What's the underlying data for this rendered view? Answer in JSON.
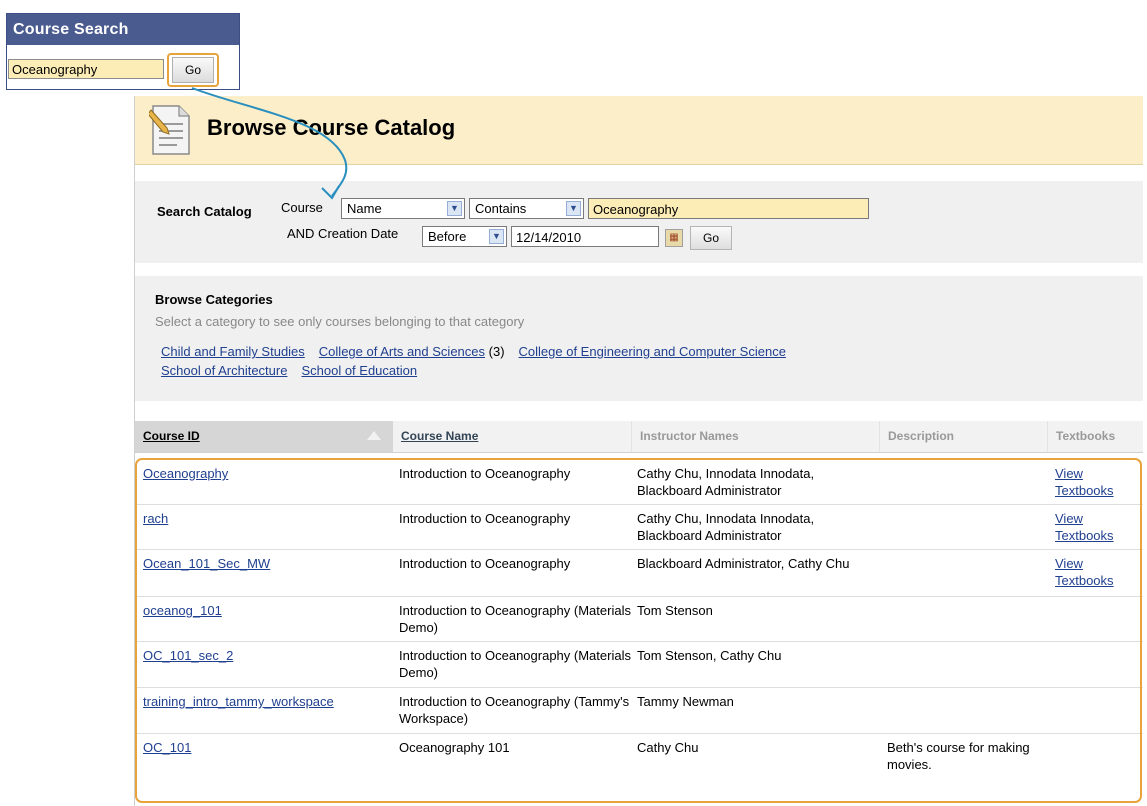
{
  "course_search": {
    "title": "Course Search",
    "input_value": "Oceanography",
    "go_label": "Go"
  },
  "catalog": {
    "title": "Browse Course Catalog",
    "search": {
      "label": "Search Catalog",
      "field_label": "Course",
      "field_select": "Name",
      "operator_select": "Contains",
      "query_value": "Oceanography",
      "date_label": "AND Creation Date",
      "date_operator": "Before",
      "date_value": "12/14/2010",
      "go_label": "Go"
    },
    "browse": {
      "title": "Browse Categories",
      "subtitle": "Select a category to see only courses belonging to that category",
      "categories": [
        {
          "label": "Child and Family Studies",
          "count": ""
        },
        {
          "label": "College of Arts and Sciences",
          "count": "(3)"
        },
        {
          "label": "College of Engineering and Computer Science",
          "count": ""
        },
        {
          "label": "School of Architecture",
          "count": ""
        },
        {
          "label": "School of Education",
          "count": ""
        }
      ]
    },
    "table": {
      "columns": [
        "Course ID",
        "Course Name",
        "Instructor Names",
        "Description",
        "Textbooks"
      ],
      "rows": [
        {
          "id": "Oceanography",
          "name": "Introduction to Oceanography",
          "instructors": "Cathy Chu, Innodata Innodata, Blackboard Administrator",
          "description": "",
          "textbooks": "View Textbooks"
        },
        {
          "id": "rach",
          "name": "Introduction to Oceanography",
          "instructors": "Cathy Chu, Innodata Innodata, Blackboard Administrator",
          "description": "",
          "textbooks": "View Textbooks"
        },
        {
          "id": "Ocean_101_Sec_MW",
          "name": "Introduction to Oceanography",
          "instructors": "Blackboard Administrator, Cathy Chu",
          "description": "",
          "textbooks": "View Textbooks"
        },
        {
          "id": "oceanog_101",
          "name": "Introduction to Oceanography (Materials Demo)",
          "instructors": "Tom Stenson",
          "description": "",
          "textbooks": ""
        },
        {
          "id": "OC_101_sec_2",
          "name": "Introduction to Oceanography (Materials Demo)",
          "instructors": "Tom Stenson, Cathy Chu",
          "description": "",
          "textbooks": ""
        },
        {
          "id": "training_intro_tammy_workspace",
          "name": "Introduction to Oceanography (Tammy's Workspace)",
          "instructors": "Tammy Newman",
          "description": "",
          "textbooks": ""
        },
        {
          "id": "OC_101",
          "name": "Oceanography 101",
          "instructors": "Cathy Chu",
          "description": "Beth's course for making movies.",
          "textbooks": ""
        }
      ]
    }
  },
  "colors": {
    "highlight": "#e8a33c",
    "arrow": "#2a8fbf",
    "title_bar": "#fbeec9",
    "input_bg": "#fcecb6"
  }
}
